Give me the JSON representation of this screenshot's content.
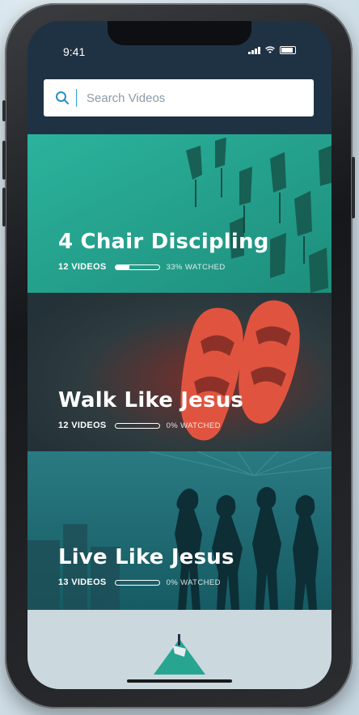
{
  "status_bar": {
    "time": "9:41"
  },
  "search": {
    "placeholder": "Search Videos",
    "value": ""
  },
  "series": [
    {
      "title": "4 Chair Discipling",
      "count_label": "12 VIDEOS",
      "watched_label": "33% WATCHED",
      "progress": 0.33,
      "accent": "#27a591"
    },
    {
      "title": "Walk Like Jesus",
      "count_label": "12 VIDEOS",
      "watched_label": "0% WATCHED",
      "progress": 0.0,
      "accent": "#e0543f"
    },
    {
      "title": "Live Like Jesus",
      "count_label": "13 VIDEOS",
      "watched_label": "0% WATCHED",
      "progress": 0.0,
      "accent": "#1f6b74"
    }
  ],
  "colors": {
    "header": "#1f3244",
    "search_divider": "#27a6d6",
    "search_icon": "#2a8fc2"
  }
}
